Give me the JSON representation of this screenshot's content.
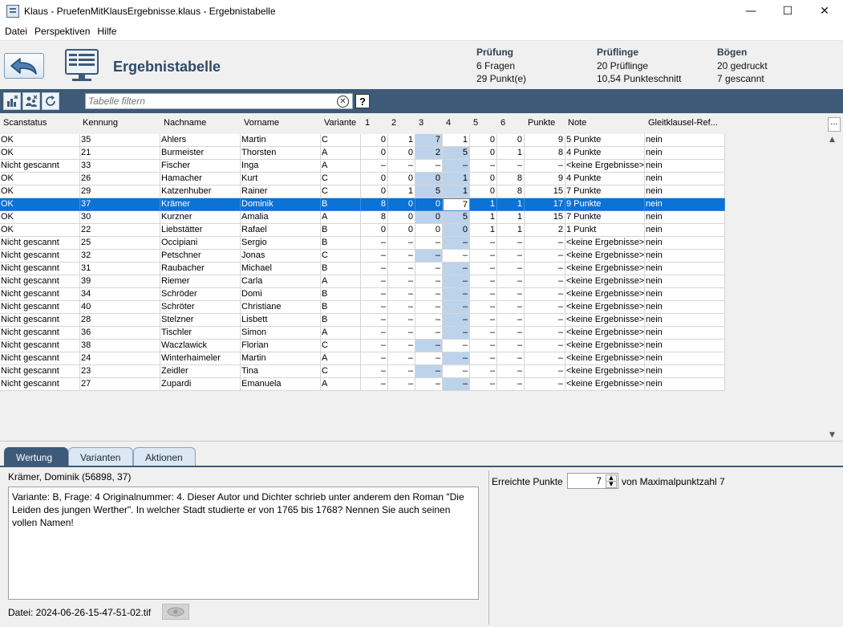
{
  "window": {
    "title": "Klaus - PruefenMitKlausErgebnisse.klaus - Ergebnistabelle",
    "controls": {
      "minimize": "—",
      "maximize": "☐",
      "close": "✕"
    }
  },
  "menu": [
    "Datei",
    "Perspektiven",
    "Hilfe"
  ],
  "header": {
    "title": "Ergebnistabelle",
    "pruefung": {
      "heading": "Prüfung",
      "line1": "6 Fragen",
      "line2": "29 Punkt(e)"
    },
    "prueflinge": {
      "heading": "Prüflinge",
      "line1": "20 Prüflinge",
      "line2": "10,54 Punkteschnitt"
    },
    "boegen": {
      "heading": "Bögen",
      "line1": "20 gedruckt",
      "line2": "7 gescannt"
    }
  },
  "toolbar": {
    "filter_placeholder": "Tabelle filtern",
    "clear_glyph": "✕",
    "help_label": "?"
  },
  "table": {
    "columns": [
      "Scanstatus",
      "Kennung",
      "Nachname",
      "Vorname",
      "Variante",
      "1",
      "2",
      "3",
      "4",
      "5",
      "6",
      "Punkte",
      "Note",
      "Gleitklausel-Ref..."
    ],
    "column_menu": "...",
    "selected_row": 5,
    "rows": [
      [
        "OK",
        "35",
        "Ahlers",
        "Martin",
        "C",
        "0",
        "1",
        "7",
        "1",
        "0",
        "0",
        "9",
        "5 Punkte",
        "nein"
      ],
      [
        "OK",
        "21",
        "Burmeister",
        "Thorsten",
        "A",
        "0",
        "0",
        "2",
        "5",
        "0",
        "1",
        "8",
        "4 Punkte",
        "nein"
      ],
      [
        "Nicht gescannt",
        "33",
        "Fischer",
        "Inga",
        "A",
        "–",
        "–",
        "–",
        "–",
        "–",
        "–",
        "–",
        "<keine Ergebnisse>",
        "nein"
      ],
      [
        "OK",
        "26",
        "Hamacher",
        "Kurt",
        "C",
        "0",
        "0",
        "0",
        "1",
        "0",
        "8",
        "9",
        "4 Punkte",
        "nein"
      ],
      [
        "OK",
        "29",
        "Katzenhuber",
        "Rainer",
        "C",
        "0",
        "1",
        "5",
        "1",
        "0",
        "8",
        "15",
        "7 Punkte",
        "nein"
      ],
      [
        "OK",
        "37",
        "Krämer",
        "Dominik",
        "B",
        "8",
        "0",
        "0",
        "7",
        "1",
        "1",
        "17",
        "9 Punkte",
        "nein"
      ],
      [
        "OK",
        "30",
        "Kurzner",
        "Amalia",
        "A",
        "8",
        "0",
        "0",
        "5",
        "1",
        "1",
        "15",
        "7 Punkte",
        "nein"
      ],
      [
        "OK",
        "22",
        "Liebstätter",
        "Rafael",
        "B",
        "0",
        "0",
        "0",
        "0",
        "1",
        "1",
        "2",
        "1 Punkt",
        "nein"
      ],
      [
        "Nicht gescannt",
        "25",
        "Occipiani",
        "Sergio",
        "B",
        "–",
        "–",
        "–",
        "–",
        "–",
        "–",
        "–",
        "<keine Ergebnisse>",
        "nein"
      ],
      [
        "Nicht gescannt",
        "32",
        "Petschner",
        "Jonas",
        "C",
        "–",
        "–",
        "–",
        "–",
        "–",
        "–",
        "–",
        "<keine Ergebnisse>",
        "nein"
      ],
      [
        "Nicht gescannt",
        "31",
        "Raubacher",
        "Michael",
        "B",
        "–",
        "–",
        "–",
        "–",
        "–",
        "–",
        "–",
        "<keine Ergebnisse>",
        "nein"
      ],
      [
        "Nicht gescannt",
        "39",
        "Riemer",
        "Carla",
        "A",
        "–",
        "–",
        "–",
        "–",
        "–",
        "–",
        "–",
        "<keine Ergebnisse>",
        "nein"
      ],
      [
        "Nicht gescannt",
        "34",
        "Schröder",
        "Domi",
        "B",
        "–",
        "–",
        "–",
        "–",
        "–",
        "–",
        "–",
        "<keine Ergebnisse>",
        "nein"
      ],
      [
        "Nicht gescannt",
        "40",
        "Schröter",
        "Christiane",
        "B",
        "–",
        "–",
        "–",
        "–",
        "–",
        "–",
        "–",
        "<keine Ergebnisse>",
        "nein"
      ],
      [
        "Nicht gescannt",
        "28",
        "Stelzner",
        "Lisbett",
        "B",
        "–",
        "–",
        "–",
        "–",
        "–",
        "–",
        "–",
        "<keine Ergebnisse>",
        "nein"
      ],
      [
        "Nicht gescannt",
        "36",
        "Tischler",
        "Simon",
        "A",
        "–",
        "–",
        "–",
        "–",
        "–",
        "–",
        "–",
        "<keine Ergebnisse>",
        "nein"
      ],
      [
        "Nicht gescannt",
        "38",
        "Waczlawick",
        "Florian",
        "C",
        "–",
        "–",
        "–",
        "–",
        "–",
        "–",
        "–",
        "<keine Ergebnisse>",
        "nein"
      ],
      [
        "Nicht gescannt",
        "24",
        "Winterhaimeler",
        "Martin",
        "A",
        "–",
        "–",
        "–",
        "–",
        "–",
        "–",
        "–",
        "<keine Ergebnisse>",
        "nein"
      ],
      [
        "Nicht gescannt",
        "23",
        "Zeidler",
        "Tina",
        "C",
        "–",
        "–",
        "–",
        "–",
        "–",
        "–",
        "–",
        "<keine Ergebnisse>",
        "nein"
      ],
      [
        "Nicht gescannt",
        "27",
        "Zupardi",
        "Emanuela",
        "A",
        "–",
        "–",
        "–",
        "–",
        "–",
        "–",
        "–",
        "<keine Ergebnisse>",
        "nein"
      ]
    ]
  },
  "tabs": [
    "Wertung",
    "Varianten",
    "Aktionen"
  ],
  "detail": {
    "person": "Krämer, Dominik (56898, 37)",
    "question": "Variante: B, Frage: 4 Originalnummer: 4. Dieser Autor und Dichter schrieb unter anderem den Roman \"Die Leiden des jungen Werther\". In welcher Stadt studierte er von 1765 bis 1768? Nennen Sie auch seinen vollen Namen!",
    "file": "Datei:  2024-06-26-15-47-51-02.tif",
    "points_label": "Erreichte Punkte",
    "points_value": "7",
    "max_label": "von Maximalpunktzahl 7"
  },
  "colors": {
    "accent": "#3d5a78",
    "selection": "#0b72d6",
    "highlight": "#bdd3ec"
  }
}
